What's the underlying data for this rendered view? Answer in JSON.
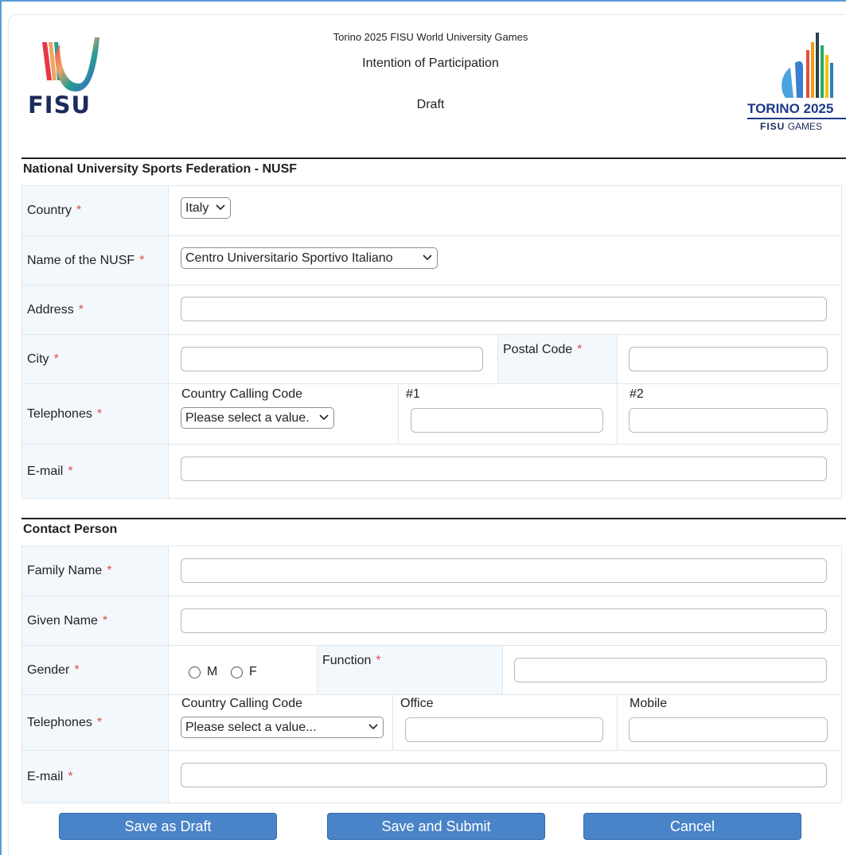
{
  "header": {
    "fisu_logo_text": "FISU",
    "line1": "Torino 2025 FISU World University Games",
    "line2": "Intention of Participation",
    "line3": "Draft",
    "torino_logo_text": "TORINO 2025",
    "torino_fisu": "FISU",
    "torino_games": "GAMES"
  },
  "nusf": {
    "title": "National University Sports Federation - NUSF",
    "required_mark": "*",
    "country_label": "Country",
    "country_value": "Italy",
    "name_label": "Name of the NUSF",
    "name_value": "Centro Universitario Sportivo Italiano",
    "address_label": "Address",
    "city_label": "City",
    "postal_code_label": "Postal Code",
    "telephones_label": "Telephones",
    "calling_code_caption": "Country Calling Code",
    "calling_code_value": "Please select a value.",
    "phone1_caption": "#1",
    "phone2_caption": "#2",
    "email_label": "E-mail"
  },
  "contact": {
    "title": "Contact Person",
    "family_name_label": "Family Name",
    "given_name_label": "Given Name",
    "gender_label": "Gender",
    "gender_options": [
      "M",
      "F"
    ],
    "function_label": "Function",
    "telephones_label": "Telephones",
    "calling_code_caption": "Country Calling Code",
    "calling_code_value": "Please select a value...",
    "office_caption": "Office",
    "mobile_caption": "Mobile",
    "email_label": "E-mail"
  },
  "buttons": {
    "save_draft": "Save as Draft",
    "save_submit": "Save and Submit",
    "cancel": "Cancel"
  },
  "colors": {
    "button_bg": "#4a84c8",
    "required": "#d9534f",
    "label_bg": "#f3f8fc",
    "frame_accent": "#5b9bd5"
  }
}
